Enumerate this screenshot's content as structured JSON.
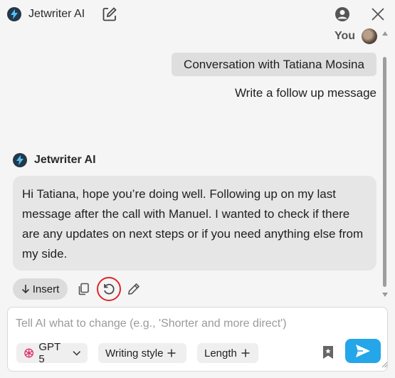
{
  "header": {
    "app_title": "Jetwriter AI",
    "icons": [
      "bolt-icon",
      "edit-icon",
      "profile-icon",
      "close-icon"
    ]
  },
  "conversation": {
    "user_label": "You",
    "context_chip": "Conversation with Tatiana Mosina",
    "user_message": "Write a follow up message",
    "assistant_name": "Jetwriter AI",
    "assistant_message": "Hi Tatiana, hope you’re doing well. Following up on my last message after the call with Manuel. I wanted to check if there are any updates on next steps or if you need anything else from my side."
  },
  "actions": {
    "insert_label": "Insert",
    "icons": [
      "copy-icon",
      "regenerate-icon",
      "pencil-icon"
    ]
  },
  "composer": {
    "placeholder": "Tell AI what to change (e.g., 'Shorter and more direct')",
    "value": "",
    "model_label": "GPT 5",
    "style_label": "Writing style",
    "length_label": "Length"
  },
  "colors": {
    "accent": "#25a6e8",
    "highlight_ring": "#e0262a",
    "logo_bg": "#24384a",
    "bubble_bg": "#e6e6e6",
    "chip_bg": "#dedede"
  }
}
